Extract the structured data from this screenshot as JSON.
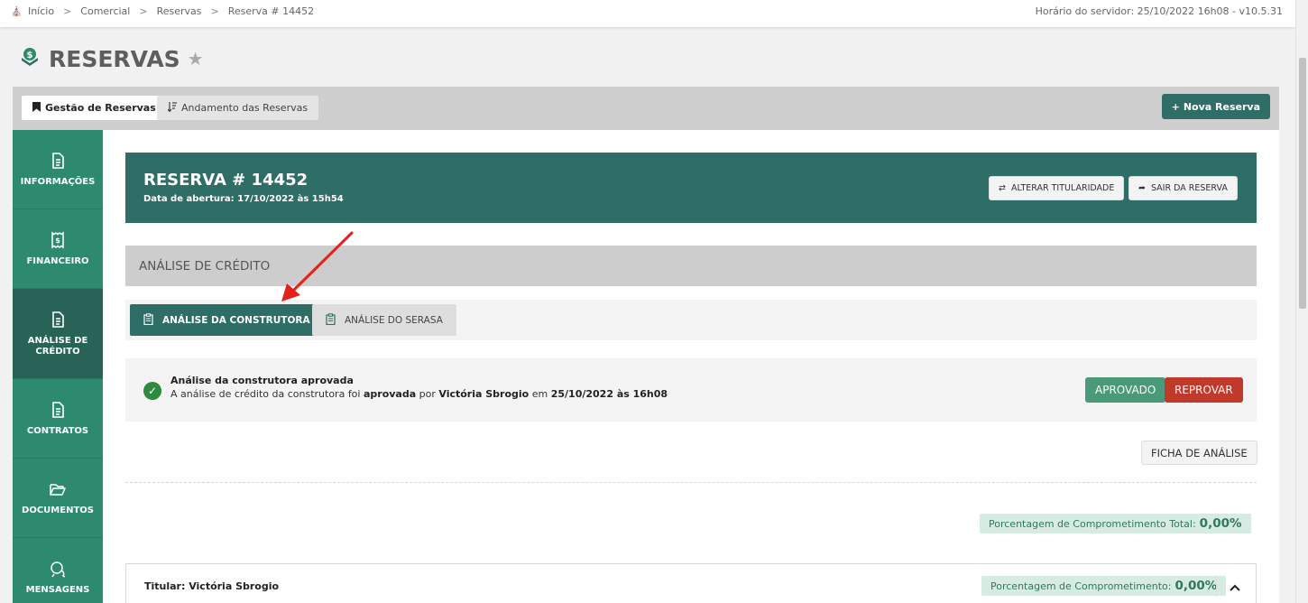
{
  "breadcrumb": {
    "items": [
      "Início",
      "Comercial",
      "Reservas",
      "Reserva # 14452"
    ],
    "separator": ">"
  },
  "server_info": "Horário do servidor: 25/10/2022 16h08 - v10.5.31",
  "page": {
    "title": "RESERVAS"
  },
  "tabs": {
    "gestao": "Gestão de Reservas",
    "andamento": "Andamento das Reservas",
    "nova_reserva": "Nova Reserva"
  },
  "sidebar": {
    "items": [
      {
        "label": "INFORMAÇÕES",
        "icon": "document-icon"
      },
      {
        "label": "FINANCEIRO",
        "icon": "receipt-dollar-icon"
      },
      {
        "label": "ANÁLISE DE CRÉDITO",
        "icon": "document-icon"
      },
      {
        "label": "CONTRATOS",
        "icon": "document-icon"
      },
      {
        "label": "DOCUMENTOS",
        "icon": "folder-open-icon"
      },
      {
        "label": "MENSAGENS",
        "icon": "chat-icon"
      }
    ]
  },
  "reserva": {
    "title": "RESERVA # 14452",
    "opened": "Data de abertura: 17/10/2022 às 15h54",
    "alterar_titularidade": "ALTERAR TITULARIDADE",
    "sair_reserva": "SAIR DA RESERVA"
  },
  "analise": {
    "section_title": "ANÁLISE DE CRÉDITO",
    "tab_construtora": "ANÁLISE DA CONSTRUTORA",
    "tab_serasa": "ANÁLISE DO SERASA",
    "status_title": "Análise da construtora aprovada",
    "desc_prefix": "A análise de crédito da construtora foi ",
    "desc_status": "aprovada",
    "desc_by": " por ",
    "desc_user": "Victória Sbrogio",
    "desc_em": " em ",
    "desc_date": "25/10/2022 às 16h08",
    "btn_aprovado": "APROVADO",
    "btn_reprovar": "REPROVAR",
    "btn_ficha": "FICHA DE ANÁLISE"
  },
  "comprometimento": {
    "total_label": "Porcentagem de Comprometimento Total:",
    "total_value": "0,00%",
    "label": "Porcentagem de Comprometimento:",
    "value": "0,00%"
  },
  "titular": {
    "label": "Titular: Victória Sbrogio"
  },
  "colors": {
    "primary": "#2e6e66",
    "sidebar": "#2e8a6e",
    "sidebar_active": "#276457",
    "approve": "#4a9a7a",
    "reject": "#c0392b",
    "arrow": "#e8201c"
  }
}
